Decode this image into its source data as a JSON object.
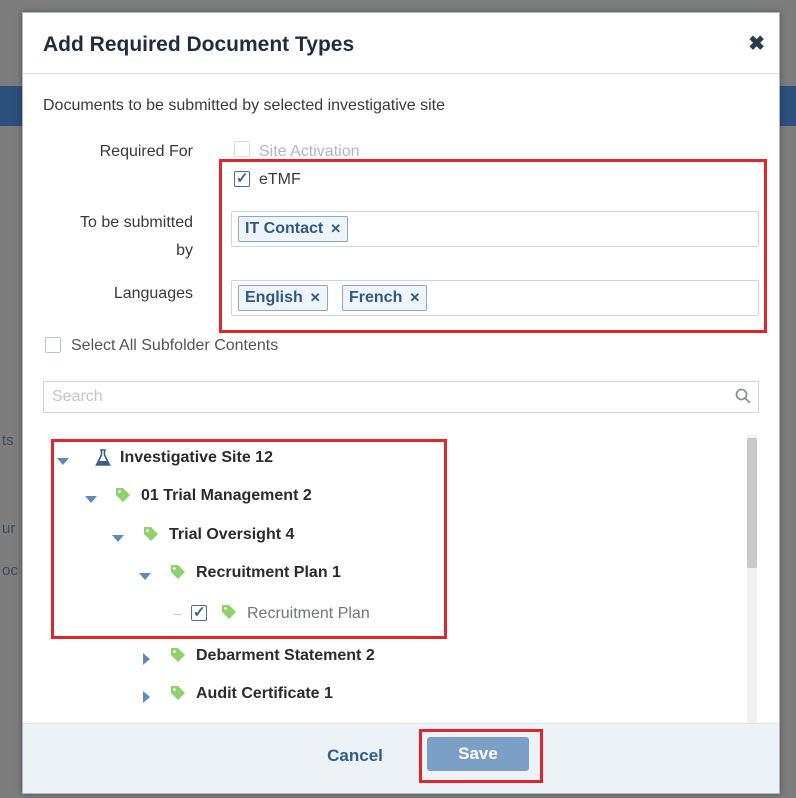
{
  "background": {
    "fragments": [
      "ts",
      "ur",
      "oc"
    ]
  },
  "dialog": {
    "title": "Add Required Document Types",
    "description": "Documents to be submitted by selected investigative site",
    "required_for_label": "Required For",
    "required_for_options": [
      {
        "label": "Site Activation",
        "checked": false,
        "disabled": true
      },
      {
        "label": "eTMF",
        "checked": true,
        "disabled": false
      }
    ],
    "submitted_by_label_line1": "To be submitted",
    "submitted_by_label_line2": "by",
    "submitted_by_tags": [
      "IT Contact"
    ],
    "languages_label": "Languages",
    "language_tags": [
      "English",
      "French"
    ],
    "tag_remove_glyph": "✕",
    "select_all_label": "Select All Subfolder Contents",
    "search_placeholder": "Search",
    "tree": [
      {
        "label": "Investigative Site 12",
        "icon": "flask-icon",
        "expanded": true
      },
      {
        "label": "01 Trial Management 2",
        "icon": "tag-icon",
        "expanded": true
      },
      {
        "label": "Trial Oversight 4",
        "icon": "tag-icon",
        "expanded": true
      },
      {
        "label": "Recruitment Plan 1",
        "icon": "tag-icon",
        "expanded": true
      },
      {
        "label": "Recruitment Plan",
        "icon": "tag-icon",
        "checked": true
      },
      {
        "label": "Debarment Statement 2",
        "icon": "tag-icon",
        "expanded": false
      },
      {
        "label": "Audit Certificate 1",
        "icon": "tag-icon",
        "expanded": false
      }
    ],
    "cancel_label": "Cancel",
    "save_label": "Save",
    "close_glyph": "✖"
  },
  "colors": {
    "accent": "#2e5a86",
    "save_button": "#7b9fc5",
    "highlight": "#e0262c",
    "tag_icon": "#8fd16a"
  }
}
